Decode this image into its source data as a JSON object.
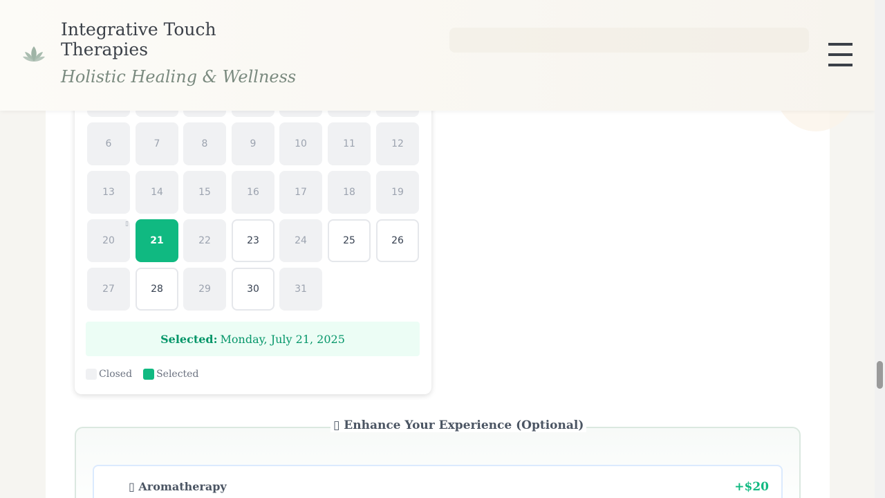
{
  "header": {
    "title": "Integrative Touch Therapies",
    "subtitle": "Holistic Healing & Wellness",
    "logo_icon": "lotus-icon",
    "menu_icon": "hamburger-menu-icon"
  },
  "calendar": {
    "weeks": [
      [
        {
          "day": "6",
          "status": "closed"
        },
        {
          "day": "7",
          "status": "closed"
        },
        {
          "day": "8",
          "status": "closed"
        },
        {
          "day": "9",
          "status": "closed"
        },
        {
          "day": "10",
          "status": "closed"
        },
        {
          "day": "11",
          "status": "closed"
        },
        {
          "day": "12",
          "status": "closed"
        }
      ],
      [
        {
          "day": "13",
          "status": "closed"
        },
        {
          "day": "14",
          "status": "closed"
        },
        {
          "day": "15",
          "status": "closed"
        },
        {
          "day": "16",
          "status": "closed"
        },
        {
          "day": "17",
          "status": "closed"
        },
        {
          "day": "18",
          "status": "closed"
        },
        {
          "day": "19",
          "status": "closed"
        }
      ],
      [
        {
          "day": "20",
          "status": "closed",
          "flag": "▯"
        },
        {
          "day": "21",
          "status": "selected"
        },
        {
          "day": "22",
          "status": "closed"
        },
        {
          "day": "23",
          "status": "open"
        },
        {
          "day": "24",
          "status": "closed"
        },
        {
          "day": "25",
          "status": "open"
        },
        {
          "day": "26",
          "status": "open"
        }
      ],
      [
        {
          "day": "27",
          "status": "closed"
        },
        {
          "day": "28",
          "status": "open"
        },
        {
          "day": "29",
          "status": "closed"
        },
        {
          "day": "30",
          "status": "open"
        },
        {
          "day": "31",
          "status": "closed"
        }
      ]
    ],
    "selected_label": "Selected:",
    "selected_value": "Monday, July 21, 2025",
    "legend": {
      "closed": "Closed",
      "selected": "Selected"
    }
  },
  "enhance": {
    "title_icon": "▯",
    "title": "Enhance Your Experience (Optional)",
    "addons": [
      {
        "icon": "▯",
        "name": "Aromatherapy",
        "price": "+$20"
      }
    ]
  },
  "colors": {
    "accent": "#10b981",
    "closed": "#f0f1f3",
    "selected_bg": "#ecfdf5"
  }
}
